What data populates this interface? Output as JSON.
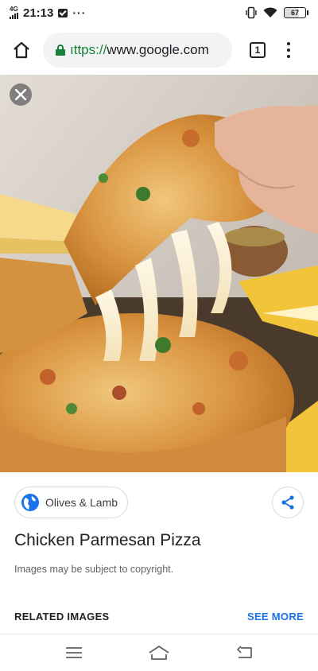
{
  "status_bar": {
    "network": "4G",
    "time": "21:13",
    "overflow": "···",
    "battery": "67",
    "icons": [
      "signal-icon",
      "message-icon",
      "vibrate-icon",
      "wifi-icon",
      "battery-icon"
    ]
  },
  "browser": {
    "url_scheme": "ıttps://",
    "url_host": "www.google.com",
    "tab_count": "1",
    "icons": [
      "home-icon",
      "lock-icon",
      "tab-switcher-icon",
      "more-vert-icon"
    ]
  },
  "image_viewer": {
    "close_icon": "close-icon",
    "source": "Olives & Lamb",
    "source_icon": "globe-icon",
    "share_icon": "share-icon",
    "title": "Chicken Parmesan Pizza",
    "copyright_note": "Images may be subject to copyright.",
    "related_label": "RELATED IMAGES",
    "see_more_label": "SEE MORE"
  },
  "nav_bar": {
    "icons": [
      "menu-icon",
      "home-icon",
      "back-icon"
    ]
  },
  "colors": {
    "accent": "#1a73e8",
    "secure": "#188038",
    "text": "#202124",
    "secondary_text": "#5f6368"
  }
}
